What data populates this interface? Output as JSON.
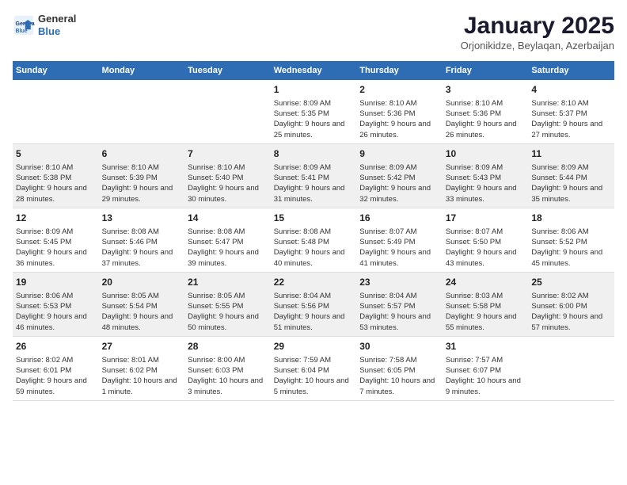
{
  "header": {
    "logo_line1": "General",
    "logo_line2": "Blue",
    "month": "January 2025",
    "location": "Orjonikidze, Beylaqan, Azerbaijan"
  },
  "days_of_week": [
    "Sunday",
    "Monday",
    "Tuesday",
    "Wednesday",
    "Thursday",
    "Friday",
    "Saturday"
  ],
  "weeks": [
    [
      {
        "num": "",
        "info": ""
      },
      {
        "num": "",
        "info": ""
      },
      {
        "num": "",
        "info": ""
      },
      {
        "num": "1",
        "info": "Sunrise: 8:09 AM\nSunset: 5:35 PM\nDaylight: 9 hours and 25 minutes."
      },
      {
        "num": "2",
        "info": "Sunrise: 8:10 AM\nSunset: 5:36 PM\nDaylight: 9 hours and 26 minutes."
      },
      {
        "num": "3",
        "info": "Sunrise: 8:10 AM\nSunset: 5:36 PM\nDaylight: 9 hours and 26 minutes."
      },
      {
        "num": "4",
        "info": "Sunrise: 8:10 AM\nSunset: 5:37 PM\nDaylight: 9 hours and 27 minutes."
      }
    ],
    [
      {
        "num": "5",
        "info": "Sunrise: 8:10 AM\nSunset: 5:38 PM\nDaylight: 9 hours and 28 minutes."
      },
      {
        "num": "6",
        "info": "Sunrise: 8:10 AM\nSunset: 5:39 PM\nDaylight: 9 hours and 29 minutes."
      },
      {
        "num": "7",
        "info": "Sunrise: 8:10 AM\nSunset: 5:40 PM\nDaylight: 9 hours and 30 minutes."
      },
      {
        "num": "8",
        "info": "Sunrise: 8:09 AM\nSunset: 5:41 PM\nDaylight: 9 hours and 31 minutes."
      },
      {
        "num": "9",
        "info": "Sunrise: 8:09 AM\nSunset: 5:42 PM\nDaylight: 9 hours and 32 minutes."
      },
      {
        "num": "10",
        "info": "Sunrise: 8:09 AM\nSunset: 5:43 PM\nDaylight: 9 hours and 33 minutes."
      },
      {
        "num": "11",
        "info": "Sunrise: 8:09 AM\nSunset: 5:44 PM\nDaylight: 9 hours and 35 minutes."
      }
    ],
    [
      {
        "num": "12",
        "info": "Sunrise: 8:09 AM\nSunset: 5:45 PM\nDaylight: 9 hours and 36 minutes."
      },
      {
        "num": "13",
        "info": "Sunrise: 8:08 AM\nSunset: 5:46 PM\nDaylight: 9 hours and 37 minutes."
      },
      {
        "num": "14",
        "info": "Sunrise: 8:08 AM\nSunset: 5:47 PM\nDaylight: 9 hours and 39 minutes."
      },
      {
        "num": "15",
        "info": "Sunrise: 8:08 AM\nSunset: 5:48 PM\nDaylight: 9 hours and 40 minutes."
      },
      {
        "num": "16",
        "info": "Sunrise: 8:07 AM\nSunset: 5:49 PM\nDaylight: 9 hours and 41 minutes."
      },
      {
        "num": "17",
        "info": "Sunrise: 8:07 AM\nSunset: 5:50 PM\nDaylight: 9 hours and 43 minutes."
      },
      {
        "num": "18",
        "info": "Sunrise: 8:06 AM\nSunset: 5:52 PM\nDaylight: 9 hours and 45 minutes."
      }
    ],
    [
      {
        "num": "19",
        "info": "Sunrise: 8:06 AM\nSunset: 5:53 PM\nDaylight: 9 hours and 46 minutes."
      },
      {
        "num": "20",
        "info": "Sunrise: 8:05 AM\nSunset: 5:54 PM\nDaylight: 9 hours and 48 minutes."
      },
      {
        "num": "21",
        "info": "Sunrise: 8:05 AM\nSunset: 5:55 PM\nDaylight: 9 hours and 50 minutes."
      },
      {
        "num": "22",
        "info": "Sunrise: 8:04 AM\nSunset: 5:56 PM\nDaylight: 9 hours and 51 minutes."
      },
      {
        "num": "23",
        "info": "Sunrise: 8:04 AM\nSunset: 5:57 PM\nDaylight: 9 hours and 53 minutes."
      },
      {
        "num": "24",
        "info": "Sunrise: 8:03 AM\nSunset: 5:58 PM\nDaylight: 9 hours and 55 minutes."
      },
      {
        "num": "25",
        "info": "Sunrise: 8:02 AM\nSunset: 6:00 PM\nDaylight: 9 hours and 57 minutes."
      }
    ],
    [
      {
        "num": "26",
        "info": "Sunrise: 8:02 AM\nSunset: 6:01 PM\nDaylight: 9 hours and 59 minutes."
      },
      {
        "num": "27",
        "info": "Sunrise: 8:01 AM\nSunset: 6:02 PM\nDaylight: 10 hours and 1 minute."
      },
      {
        "num": "28",
        "info": "Sunrise: 8:00 AM\nSunset: 6:03 PM\nDaylight: 10 hours and 3 minutes."
      },
      {
        "num": "29",
        "info": "Sunrise: 7:59 AM\nSunset: 6:04 PM\nDaylight: 10 hours and 5 minutes."
      },
      {
        "num": "30",
        "info": "Sunrise: 7:58 AM\nSunset: 6:05 PM\nDaylight: 10 hours and 7 minutes."
      },
      {
        "num": "31",
        "info": "Sunrise: 7:57 AM\nSunset: 6:07 PM\nDaylight: 10 hours and 9 minutes."
      },
      {
        "num": "",
        "info": ""
      }
    ]
  ]
}
